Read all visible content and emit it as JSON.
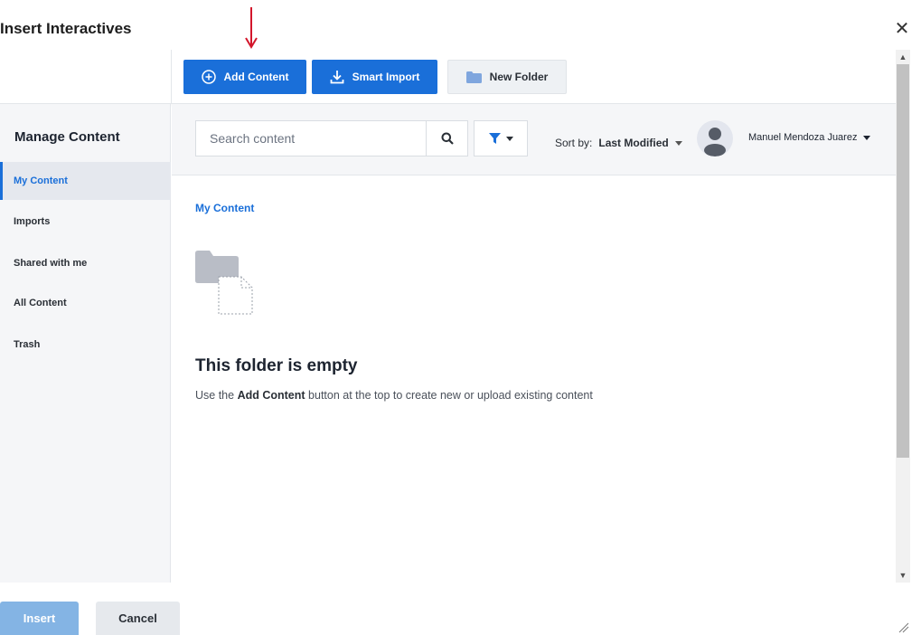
{
  "dialog": {
    "title": "Insert Interactives",
    "close_icon": "close-icon"
  },
  "toolbar": {
    "add_content": "Add Content",
    "smart_import": "Smart Import",
    "new_folder": "New Folder",
    "accent": "#1a6fd9"
  },
  "sidebar": {
    "title": "Manage Content",
    "items": [
      {
        "label": "My Content",
        "active": true
      },
      {
        "label": "Imports"
      },
      {
        "label": "Shared with me"
      },
      {
        "label": "All Content"
      },
      {
        "label": "Trash"
      }
    ]
  },
  "search": {
    "placeholder": "Search content"
  },
  "sort": {
    "prefix": "Sort by:",
    "value": "Last Modified"
  },
  "user": {
    "name": "Manuel Mendoza Juarez"
  },
  "breadcrumb": "My Content",
  "empty": {
    "title": "This folder is empty",
    "desc_prefix": "Use the",
    "desc_bold": "Add Content",
    "desc_suffix": "button at the top to create new or upload existing content"
  },
  "footer": {
    "insert": "Insert",
    "cancel": "Cancel"
  }
}
